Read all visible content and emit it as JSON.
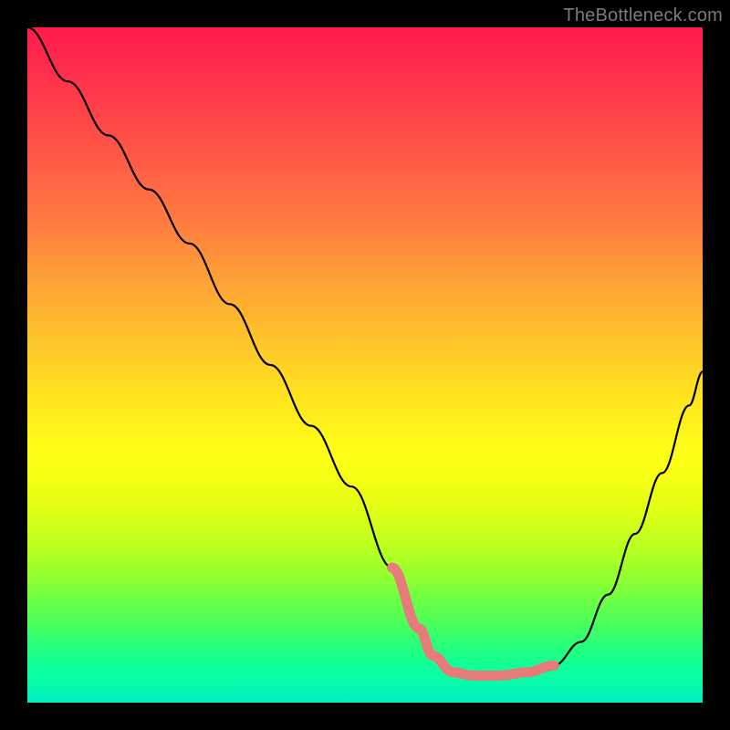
{
  "watermark": {
    "text": "TheBottleneck.com"
  },
  "chart_data": {
    "type": "line",
    "title": "",
    "xlabel": "",
    "ylabel": "",
    "ylim": [
      0,
      100
    ],
    "xlim": [
      0,
      100
    ],
    "grid": false,
    "legend": false,
    "series": [
      {
        "name": "black-curve",
        "color": "#000000",
        "width": 2.2,
        "x": [
          0,
          6,
          12,
          18,
          24,
          30,
          36,
          42,
          48,
          54,
          58,
          60,
          63,
          66,
          70,
          74,
          78,
          82,
          86,
          90,
          94,
          98,
          100
        ],
        "values": [
          100,
          92,
          84,
          76,
          68,
          59,
          50,
          41,
          32,
          20,
          11,
          7,
          4.5,
          4,
          4,
          4.5,
          5.5,
          9,
          16,
          25,
          34,
          44,
          49
        ]
      },
      {
        "name": "pink-highlight",
        "color": "#e77a7a",
        "width": 11,
        "x": [
          54,
          58,
          60,
          63,
          66,
          70,
          74,
          78
        ],
        "values": [
          20,
          11,
          7,
          4.5,
          4,
          4,
          4.5,
          5.5
        ]
      }
    ],
    "background_gradient": {
      "stops": [
        {
          "pos": 0,
          "color": "#ff1a4e"
        },
        {
          "pos": 63,
          "color": "#ffff17"
        },
        {
          "pos": 100,
          "color": "#02eec3"
        }
      ]
    }
  }
}
